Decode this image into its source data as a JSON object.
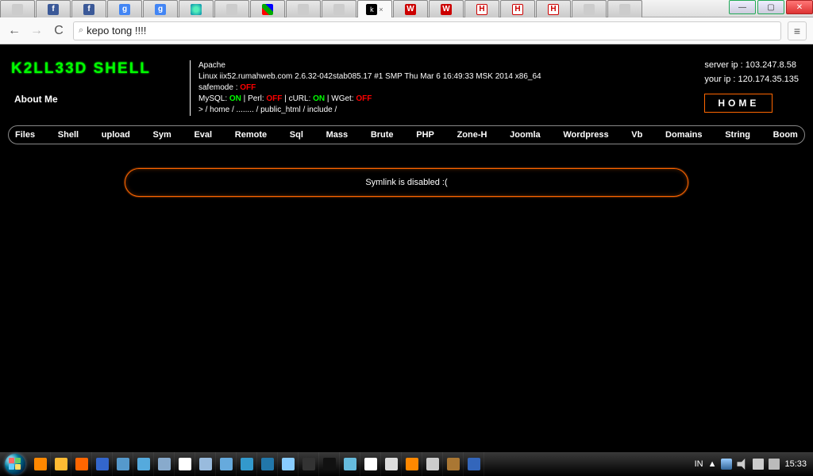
{
  "window": {
    "minimize": "—",
    "maximize": "▢",
    "close": "✕"
  },
  "tabs": [
    {
      "fav": "",
      "label": ""
    },
    {
      "fav": "f",
      "label": ""
    },
    {
      "fav": "f",
      "label": ""
    },
    {
      "fav": "g",
      "label": ""
    },
    {
      "fav": "g",
      "label": ""
    },
    {
      "fav": "●",
      "label": ""
    },
    {
      "fav": "",
      "label": ""
    },
    {
      "fav": "J",
      "label": ""
    },
    {
      "fav": "0",
      "label": ""
    },
    {
      "fav": "",
      "label": ""
    },
    {
      "fav": "k",
      "label": "",
      "active": true
    },
    {
      "fav": "W",
      "label": ""
    },
    {
      "fav": "W",
      "label": ""
    },
    {
      "fav": "H",
      "label": ""
    },
    {
      "fav": "H",
      "label": ""
    },
    {
      "fav": "H",
      "label": ""
    },
    {
      "fav": "",
      "label": ""
    },
    {
      "fav": "",
      "label": ""
    }
  ],
  "nav": {
    "back": "←",
    "forward": "→",
    "reload": "C",
    "search_icon": "⌕",
    "url": "kepo tong !!!!",
    "menu": "≡"
  },
  "page": {
    "title": "K2LL33D SHELL",
    "about": "About Me",
    "server_software": "Apache",
    "os": "Linux iix52.rumahweb.com 2.6.32-042stab085.17 #1 SMP Thu Mar 6 16:49:33 MSK 2014 x86_64",
    "safemode_label": "safemode : ",
    "safemode_value": "OFF",
    "mysql_label": "MySQL: ",
    "mysql_value": "ON",
    "perl_label": "Perl: ",
    "perl_value": "OFF",
    "curl_label": "cURL: ",
    "curl_value": "ON",
    "wget_label": "WGet: ",
    "wget_value": "OFF",
    "sep": " | ",
    "path_prefix": " > ",
    "path_parts": [
      "/ home",
      "/ ........",
      "/ public_html",
      "/ include",
      "/"
    ],
    "server_ip_label": "server ip : ",
    "server_ip": "103.247.8.58",
    "your_ip_label": "your ip : ",
    "your_ip": "120.174.35.135",
    "home_btn": "HOME",
    "menu": [
      "Files",
      "Shell",
      "upload",
      "Sym",
      "Eval",
      "Remote",
      "Sql",
      "Mass",
      "Brute",
      "PHP",
      "Zone-H",
      "Joomla",
      "Wordpress",
      "Vb",
      "Domains",
      "String",
      "Boom"
    ],
    "panel_msg": "Symlink is disabled :("
  },
  "taskbar": {
    "lang": "IN",
    "tray_up": "▲",
    "clock": "15:33"
  }
}
